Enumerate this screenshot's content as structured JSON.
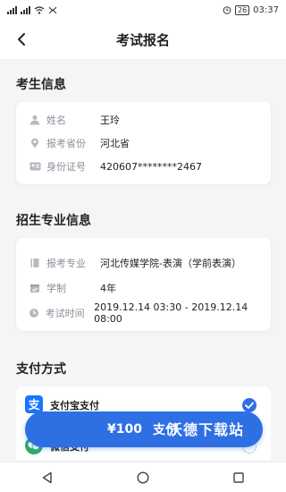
{
  "status_bar": {
    "left_text": "ᵐᵃᵐ",
    "battery": "26",
    "time": "03:37"
  },
  "header": {
    "title": "考试报名"
  },
  "candidate": {
    "section_title": "考生信息",
    "rows": [
      {
        "label": "姓名",
        "value": "王玲",
        "icon": "person-icon"
      },
      {
        "label": "报考省份",
        "value": "河北省",
        "icon": "location-pin-icon"
      },
      {
        "label": "身份证号",
        "value": "420607********2467",
        "icon": "id-card-icon"
      }
    ]
  },
  "major": {
    "section_title": "招生专业信息",
    "rows": [
      {
        "label": "报考专业",
        "value": "河北传媒学院-表演（学前表演）",
        "icon": "book-icon"
      },
      {
        "label": "学制",
        "value": "4年",
        "icon": "calendar-icon"
      },
      {
        "label": "考试时间",
        "value": "2019.12.14 03:30 - 2019.12.14 08:00",
        "icon": "clock-icon"
      }
    ]
  },
  "payment": {
    "section_title": "支付方式",
    "options": [
      {
        "name": "支付宝支付",
        "selected": true,
        "icon": "alipay-icon",
        "color": "#1677ff"
      },
      {
        "name": "微信支付",
        "selected": false,
        "icon": "wechat-icon",
        "color": "#2aae67"
      }
    ],
    "amount": "¥100",
    "button_label": "支付",
    "watermark": "沃德下载站"
  },
  "colors": {
    "accent": "#2f6fe4",
    "background": "#f4f5f7",
    "muted_text": "#8a8f99"
  }
}
